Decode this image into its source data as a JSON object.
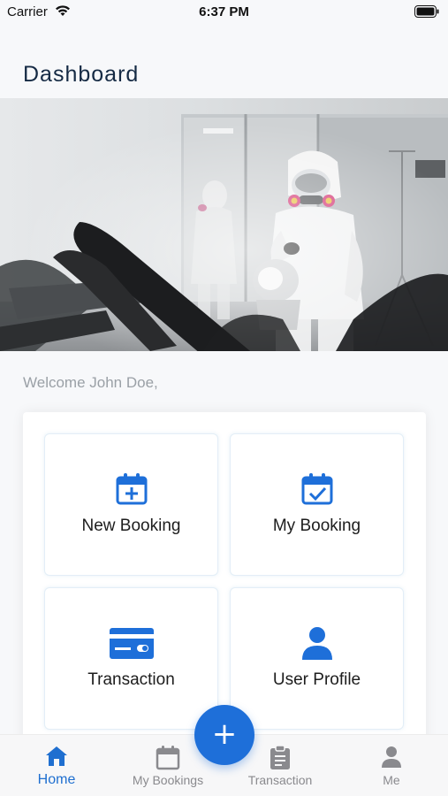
{
  "status_bar": {
    "carrier": "Carrier",
    "time": "6:37 PM"
  },
  "header": {
    "title": "Dashboard"
  },
  "welcome": "Welcome John Doe,",
  "cards": [
    {
      "label": "New Booking",
      "icon": "calendar-plus-icon"
    },
    {
      "label": "My Booking",
      "icon": "calendar-check-icon"
    },
    {
      "label": "Transaction",
      "icon": "credit-card-icon"
    },
    {
      "label": "User Profile",
      "icon": "user-icon"
    }
  ],
  "tab_bar": {
    "tabs": [
      {
        "label": "Home",
        "icon": "home-icon",
        "active": true
      },
      {
        "label": "My Bookings",
        "icon": "calendar-icon",
        "active": false
      },
      {
        "label": "Transaction",
        "icon": "clipboard-icon",
        "active": false
      },
      {
        "label": "Me",
        "icon": "person-icon",
        "active": false
      }
    ],
    "fab_label": "+"
  },
  "colors": {
    "accent": "#1e6fd9",
    "title": "#152a44",
    "muted": "#9aa0a6"
  }
}
